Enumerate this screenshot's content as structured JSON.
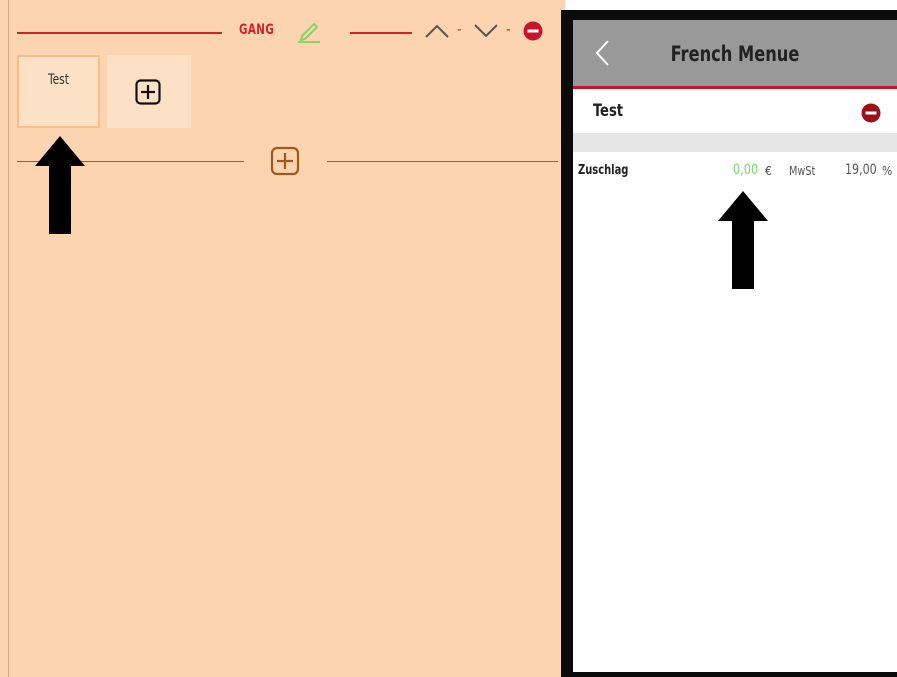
{
  "course_editor": {
    "gang_label": "GANG",
    "dash": "-",
    "tiles": [
      {
        "label": "Test"
      }
    ],
    "colors": {
      "background": "#fdd4b0",
      "accent_red": "#d4202a",
      "edit_green": "#8dcf6a",
      "add_brown": "#9a5b1f"
    }
  },
  "detail_panel": {
    "nav_title": "French Menue",
    "item_name": "Test",
    "surcharge": {
      "label": "Zuschlag",
      "value": "0,00",
      "currency": "€",
      "vat_label": "MwSt",
      "vat_value": "19,00",
      "vat_unit": "%"
    },
    "colors": {
      "navbar": "#999999",
      "navbar_border": "#c8142a",
      "value_green": "#7bd56c"
    }
  }
}
